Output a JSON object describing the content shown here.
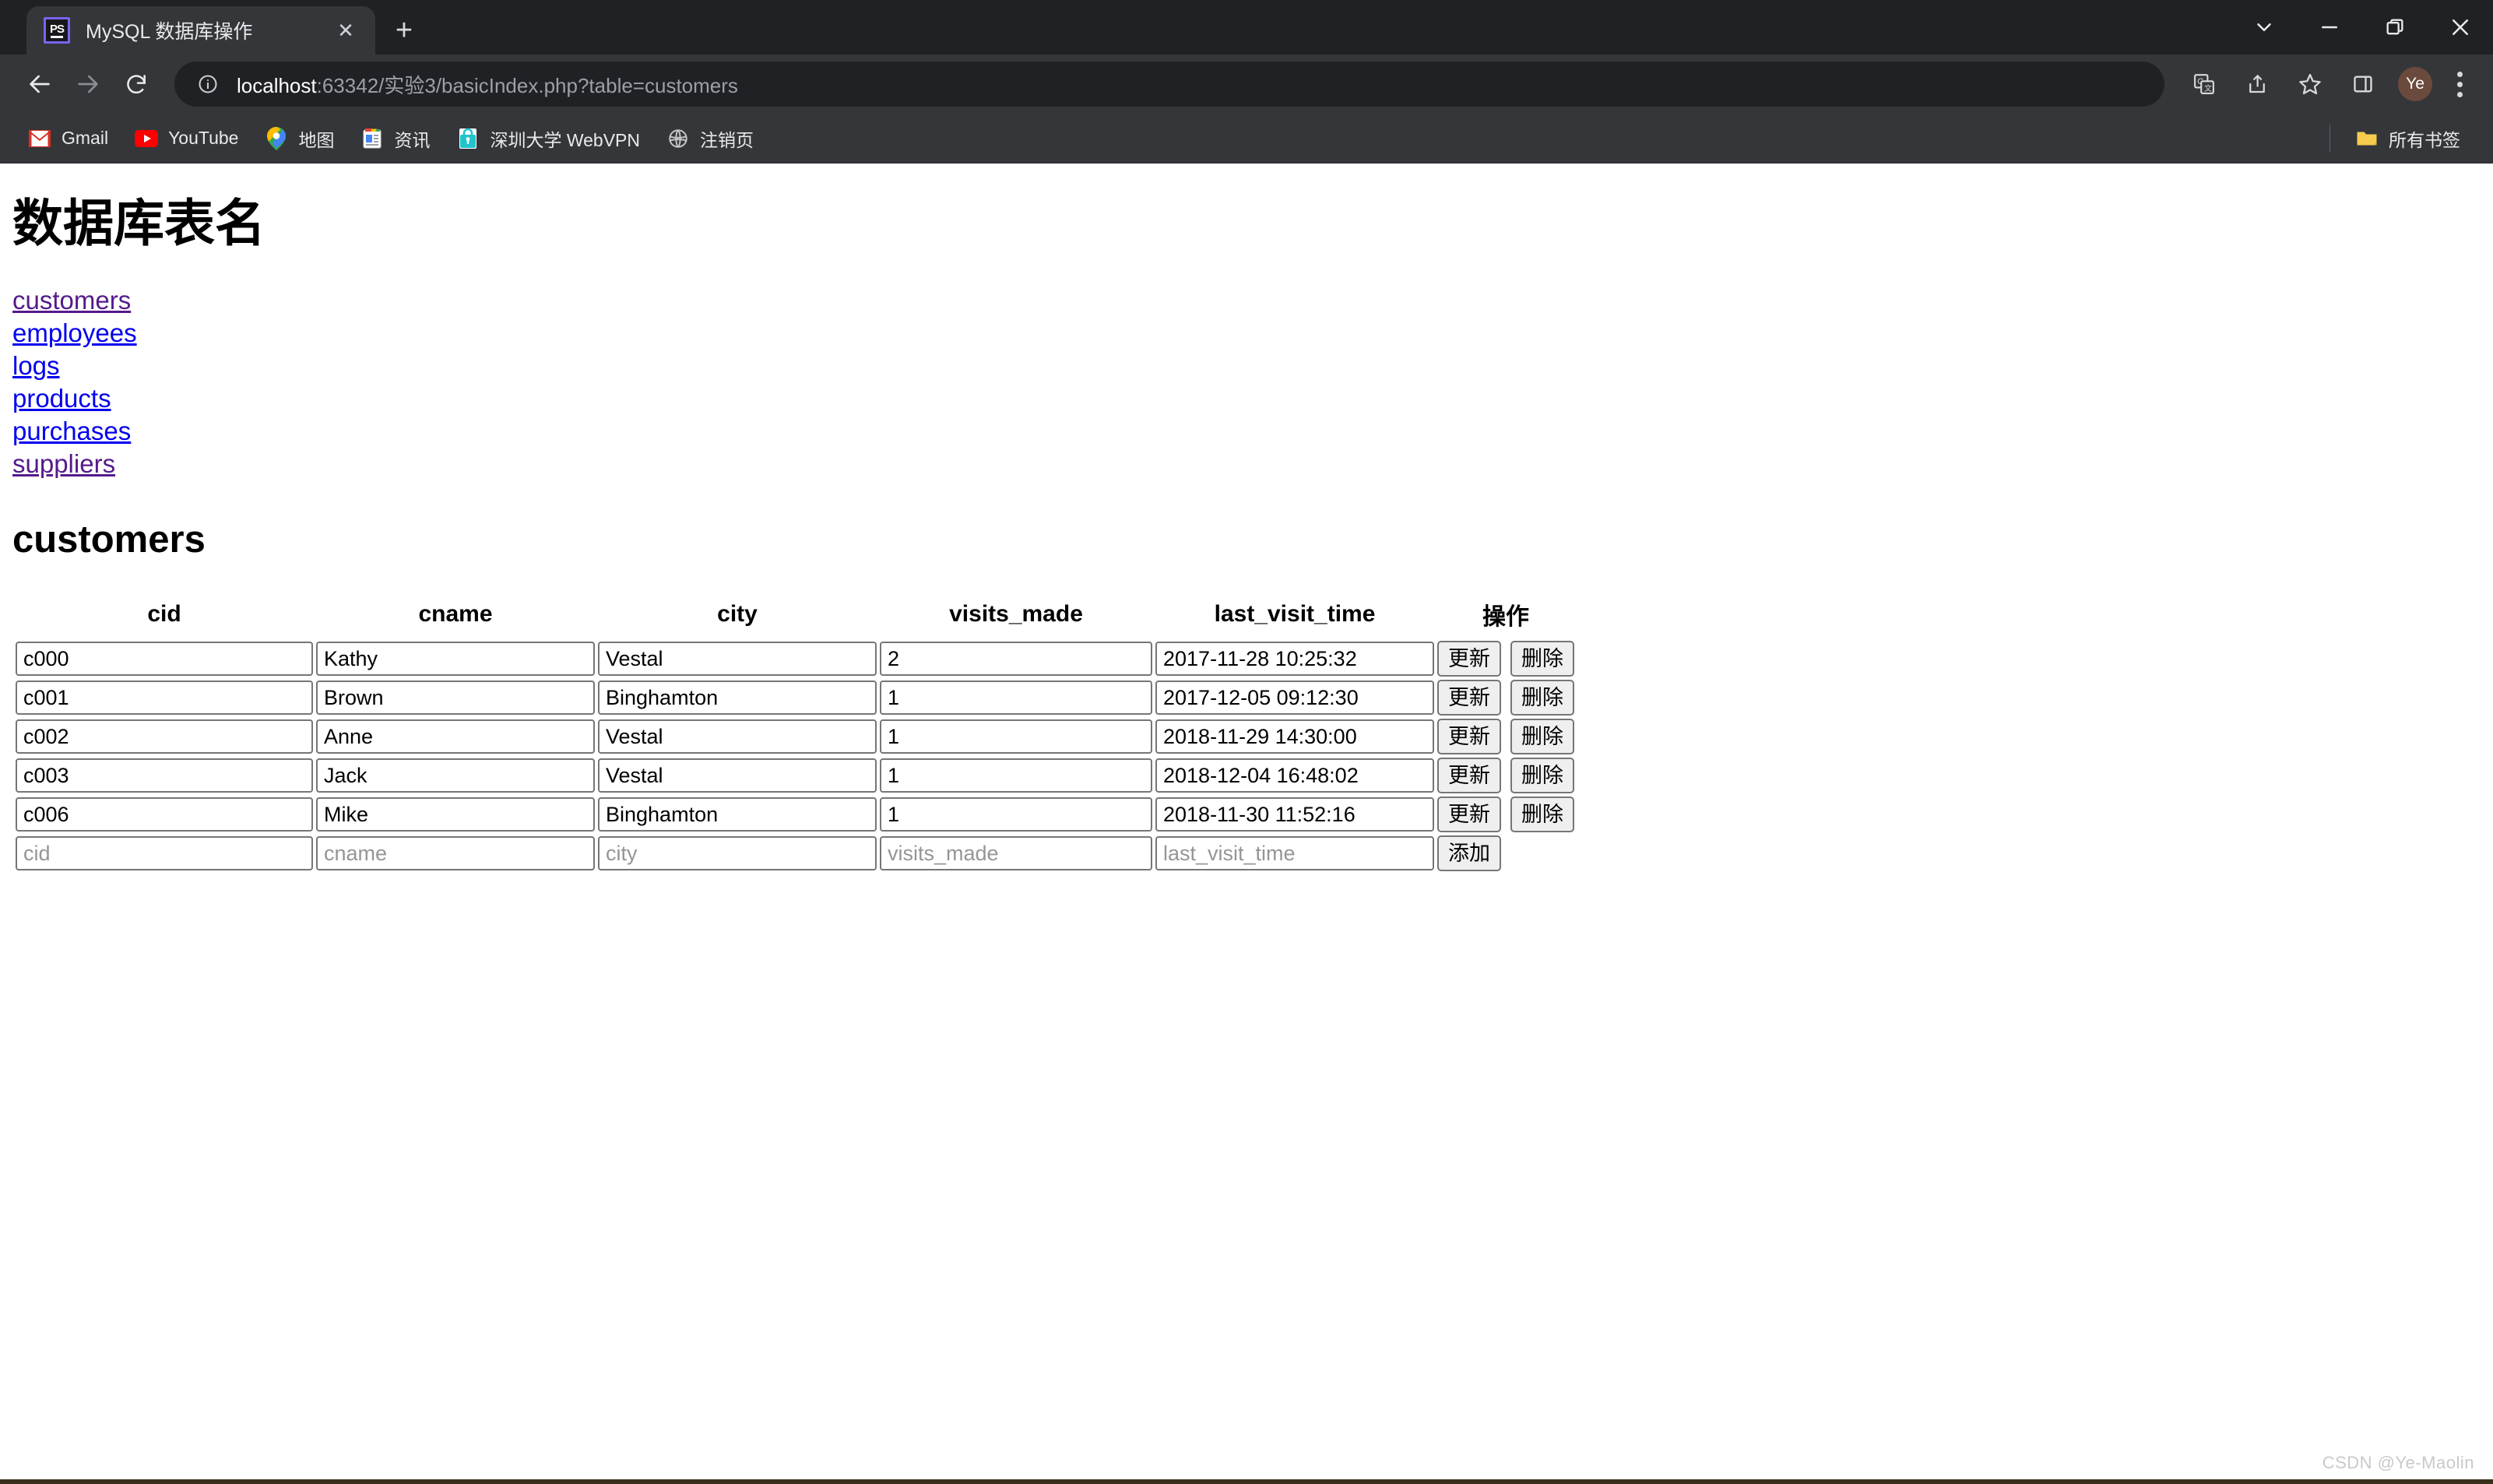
{
  "browser": {
    "tab": {
      "favicon": "phpstorm-icon",
      "favicon_text": "PS",
      "title": "MySQL 数据库操作",
      "close_glyph": "✕",
      "newtab_glyph": "+"
    },
    "window_controls": {
      "tab_search": "tab-search-icon",
      "minimize": "minimize-icon",
      "maximize": "maximize-icon",
      "close": "close-icon"
    },
    "toolbar": {
      "back": "back-arrow-icon",
      "forward": "forward-arrow-icon",
      "reload": "reload-icon",
      "site_info": "info-circle-icon",
      "url_host": "localhost",
      "url_rest": ":63342/实验3/basicIndex.php?table=customers",
      "url_full": "localhost:63342/实验3/basicIndex.php?table=customers",
      "translate": "translate-icon",
      "share": "share-icon",
      "bookmark_star": "star-icon",
      "side_panel": "side-panel-icon",
      "profile_initials": "Ye",
      "menu": "three-dot-menu-icon"
    },
    "bookmarks": [
      {
        "label": "Gmail",
        "icon": "gmail-icon"
      },
      {
        "label": "YouTube",
        "icon": "youtube-icon"
      },
      {
        "label": "地图",
        "icon": "google-maps-icon"
      },
      {
        "label": "资讯",
        "icon": "google-news-icon"
      },
      {
        "label": "深圳大学 WebVPN",
        "icon": "lock-icon"
      },
      {
        "label": "注销页",
        "icon": "globe-icon"
      }
    ],
    "bookmarks_all": {
      "label": "所有书签",
      "icon": "folder-icon"
    }
  },
  "page": {
    "heading": "数据库表名",
    "table_links": [
      {
        "label": "customers",
        "state": "visited"
      },
      {
        "label": "employees",
        "state": "unvisited"
      },
      {
        "label": "logs",
        "state": "unvisited"
      },
      {
        "label": "products",
        "state": "unvisited"
      },
      {
        "label": "purchases",
        "state": "unvisited"
      },
      {
        "label": "suppliers",
        "state": "visited"
      }
    ],
    "current_table": "customers",
    "columns": [
      "cid",
      "cname",
      "city",
      "visits_made",
      "last_visit_time",
      "操作"
    ],
    "rows": [
      {
        "cid": "c000",
        "cname": "Kathy",
        "city": "Vestal",
        "visits_made": "2",
        "last_visit_time": "2017-11-28 10:25:32"
      },
      {
        "cid": "c001",
        "cname": "Brown",
        "city": "Binghamton",
        "visits_made": "1",
        "last_visit_time": "2017-12-05 09:12:30"
      },
      {
        "cid": "c002",
        "cname": "Anne",
        "city": "Vestal",
        "visits_made": "1",
        "last_visit_time": "2018-11-29 14:30:00"
      },
      {
        "cid": "c003",
        "cname": "Jack",
        "city": "Vestal",
        "visits_made": "1",
        "last_visit_time": "2018-12-04 16:48:02"
      },
      {
        "cid": "c006",
        "cname": "Mike",
        "city": "Binghamton",
        "visits_made": "1",
        "last_visit_time": "2018-11-30 11:52:16"
      }
    ],
    "new_row_placeholders": {
      "cid": "cid",
      "cname": "cname",
      "city": "city",
      "visits_made": "visits_made",
      "last_visit_time": "last_visit_time"
    },
    "buttons": {
      "update": "更新",
      "delete": "删除",
      "add": "添加"
    },
    "watermark": "CSDN @Ye-Maolin"
  }
}
